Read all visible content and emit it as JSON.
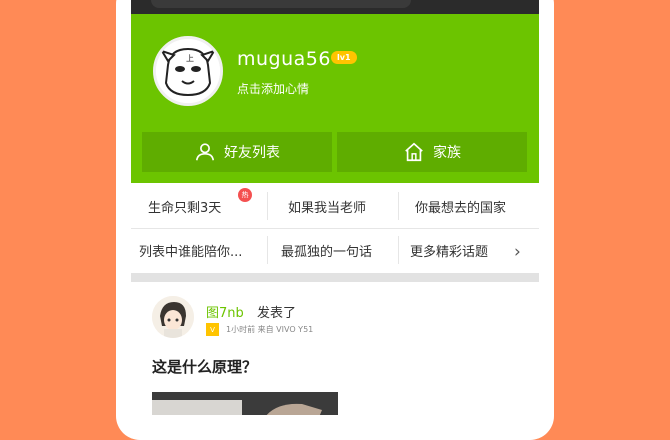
{
  "profile": {
    "username": "mugua56",
    "level_badge": "lv1",
    "mood_placeholder": "点击添加心情"
  },
  "actions": {
    "friends_label": "好友列表",
    "family_label": "家族"
  },
  "topics": {
    "row1": [
      "生命只剩3天",
      "如果我当老师",
      "你最想去的国家"
    ],
    "row2": [
      "列表中谁能陪你...",
      "最孤独的一句话",
      "更多精彩话题"
    ],
    "hot_badge": "热",
    "more_icon": "chevron-right-icon"
  },
  "post": {
    "author": "图7nb",
    "action": "发表了",
    "vip_badge": "V",
    "meta": "1小时前  来自 VIVO Y51",
    "title": "这是什么原理？"
  },
  "colors": {
    "background": "#ff8a56",
    "header_green": "#6cc400",
    "button_green": "#5fad00",
    "badge_yellow": "#ffc400",
    "hot_red": "#f45050"
  }
}
